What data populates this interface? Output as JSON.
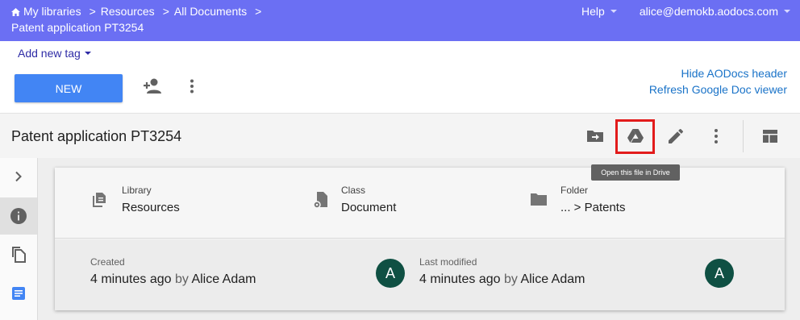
{
  "header": {
    "breadcrumbs": [
      "My libraries",
      "Resources",
      "All Documents"
    ],
    "breadcrumb_sep": ">",
    "doc_title": "Patent application PT3254",
    "help_label": "Help",
    "user_email": "alice@demokb.aodocs.com"
  },
  "toolbar": {
    "add_tag_label": "Add new tag",
    "new_label": "NEW",
    "hide_header_link": "Hide AODocs header",
    "refresh_viewer_link": "Refresh Google Doc viewer"
  },
  "docbar": {
    "title": "Patent application PT3254",
    "tooltip": "Open this file in Drive"
  },
  "details": {
    "library": {
      "label": "Library",
      "value": "Resources"
    },
    "class": {
      "label": "Class",
      "value": "Document"
    },
    "folder": {
      "label": "Folder",
      "value": "... > Patents"
    },
    "created": {
      "label": "Created",
      "time": "4 minutes ago",
      "by": "by",
      "user": "Alice Adam",
      "avatar": "A"
    },
    "modified": {
      "label": "Last modified",
      "time": "4 minutes ago",
      "by": "by",
      "user": "Alice Adam",
      "avatar": "A"
    }
  },
  "colors": {
    "topbar": "#6b6ff3",
    "primary_button": "#4285f4",
    "link": "#1a73c8",
    "highlight_box": "#e21b1b",
    "avatar": "#0f5043"
  },
  "icons": [
    "home-icon",
    "add-person-icon",
    "more-vert-icon",
    "move-to-folder-icon",
    "google-drive-icon",
    "edit-pencil-icon",
    "layout-panel-icon",
    "chevron-right-icon",
    "info-icon",
    "copy-icon",
    "document-icon",
    "library-icon",
    "class-settings-icon",
    "folder-icon"
  ]
}
